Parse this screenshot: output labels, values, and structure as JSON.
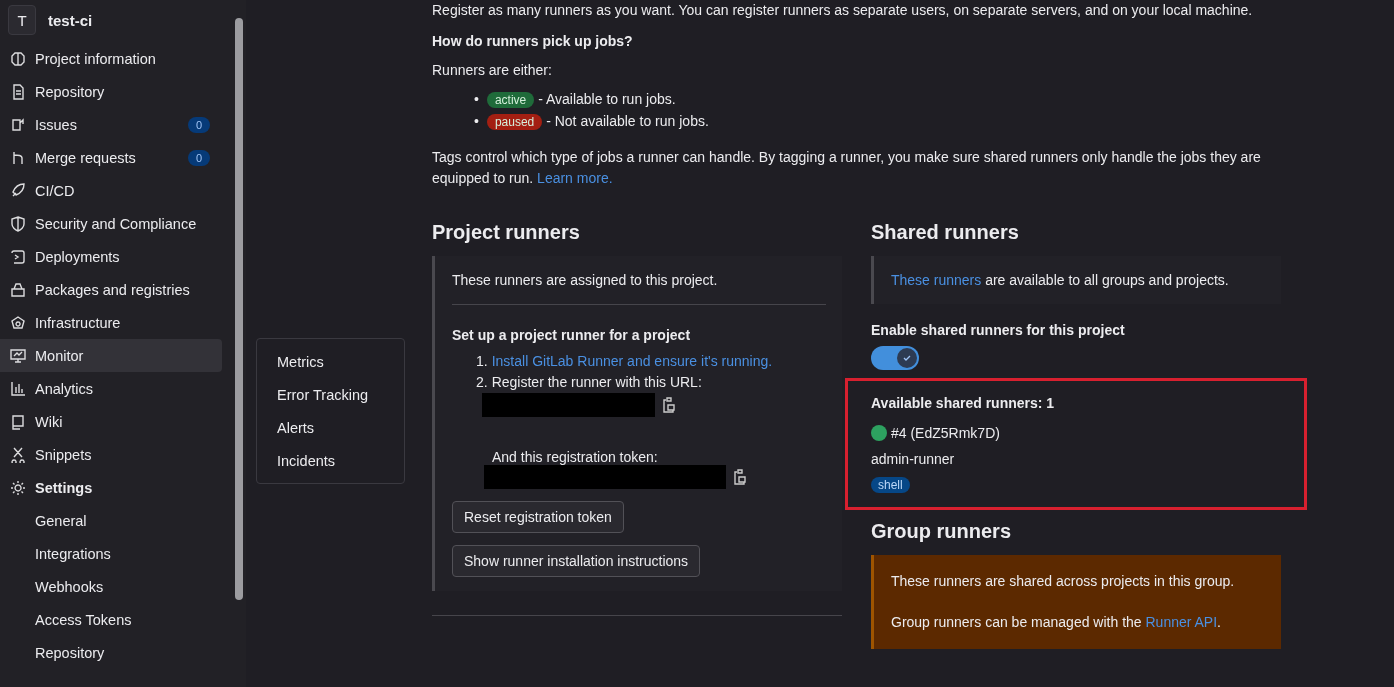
{
  "project": {
    "avatar": "T",
    "name": "test-ci"
  },
  "sidebar": {
    "items": [
      {
        "label": "Project information",
        "selected": false
      },
      {
        "label": "Repository",
        "selected": false
      },
      {
        "label": "Issues",
        "count": "0",
        "selected": false
      },
      {
        "label": "Merge requests",
        "count": "0",
        "selected": false
      },
      {
        "label": "CI/CD",
        "selected": false
      },
      {
        "label": "Security and Compliance",
        "selected": false
      },
      {
        "label": "Deployments",
        "selected": false
      },
      {
        "label": "Packages and registries",
        "selected": false
      },
      {
        "label": "Infrastructure",
        "selected": false
      },
      {
        "label": "Monitor",
        "selected": true
      },
      {
        "label": "Analytics",
        "selected": false
      },
      {
        "label": "Wiki",
        "selected": false
      },
      {
        "label": "Snippets",
        "selected": false
      },
      {
        "label": "Settings",
        "selected": false,
        "children": [
          {
            "label": "General"
          },
          {
            "label": "Integrations"
          },
          {
            "label": "Webhooks"
          },
          {
            "label": "Access Tokens"
          },
          {
            "label": "Repository"
          }
        ]
      }
    ]
  },
  "flyout_menu": [
    "Metrics",
    "Error Tracking",
    "Alerts",
    "Incidents"
  ],
  "intro": {
    "text": "Register as many runners as you want. You can register runners as separate users, on separate servers, and on your local machine.",
    "question": "How do runners pick up jobs?",
    "either": "Runners are either:",
    "states": [
      {
        "bullet": "•",
        "badge": "active",
        "color": "#1f6b3a",
        "text": " - Available to run jobs."
      },
      {
        "bullet": "•",
        "badge": "paused",
        "color": "#a31f12",
        "text": " - Not available to run jobs."
      }
    ],
    "tags_text": "Tags control which type of jobs a runner can handle. By tagging a runner, you make sure shared runners only handle the jobs they are equipped to run.",
    "learn_more": "Learn more."
  },
  "project_runners": {
    "title": "Project runners",
    "assigned": "These runners are assigned to this project.",
    "setup_title": "Set up a project runner for a project",
    "step1_number": "1.",
    "step2_number": "2.",
    "step1_link": "Install GitLab Runner and ensure it's running.",
    "step2": "Register the runner with this URL:",
    "token_label": "And this registration token:",
    "buttons": [
      "Reset registration token",
      "Show runner installation instructions"
    ]
  },
  "shared_runners": {
    "title": "Shared runners",
    "info_link": "These runners",
    "info_text": " are available to all groups and projects.",
    "toggle_label": "Enable shared runners for this project",
    "enabled": true,
    "available": "Available shared runners: 1",
    "runner": {
      "id": "#4 (EdZ5Rmk7D)",
      "color": "#2da160",
      "name": "admin-runner",
      "tags": [
        "shell"
      ]
    }
  },
  "group_runners": {
    "title": "Group runners",
    "text1": "These runners are shared across projects in this group.",
    "text2": "Group runners can be managed with the ",
    "link": "Runner API",
    "text2_end": "."
  }
}
